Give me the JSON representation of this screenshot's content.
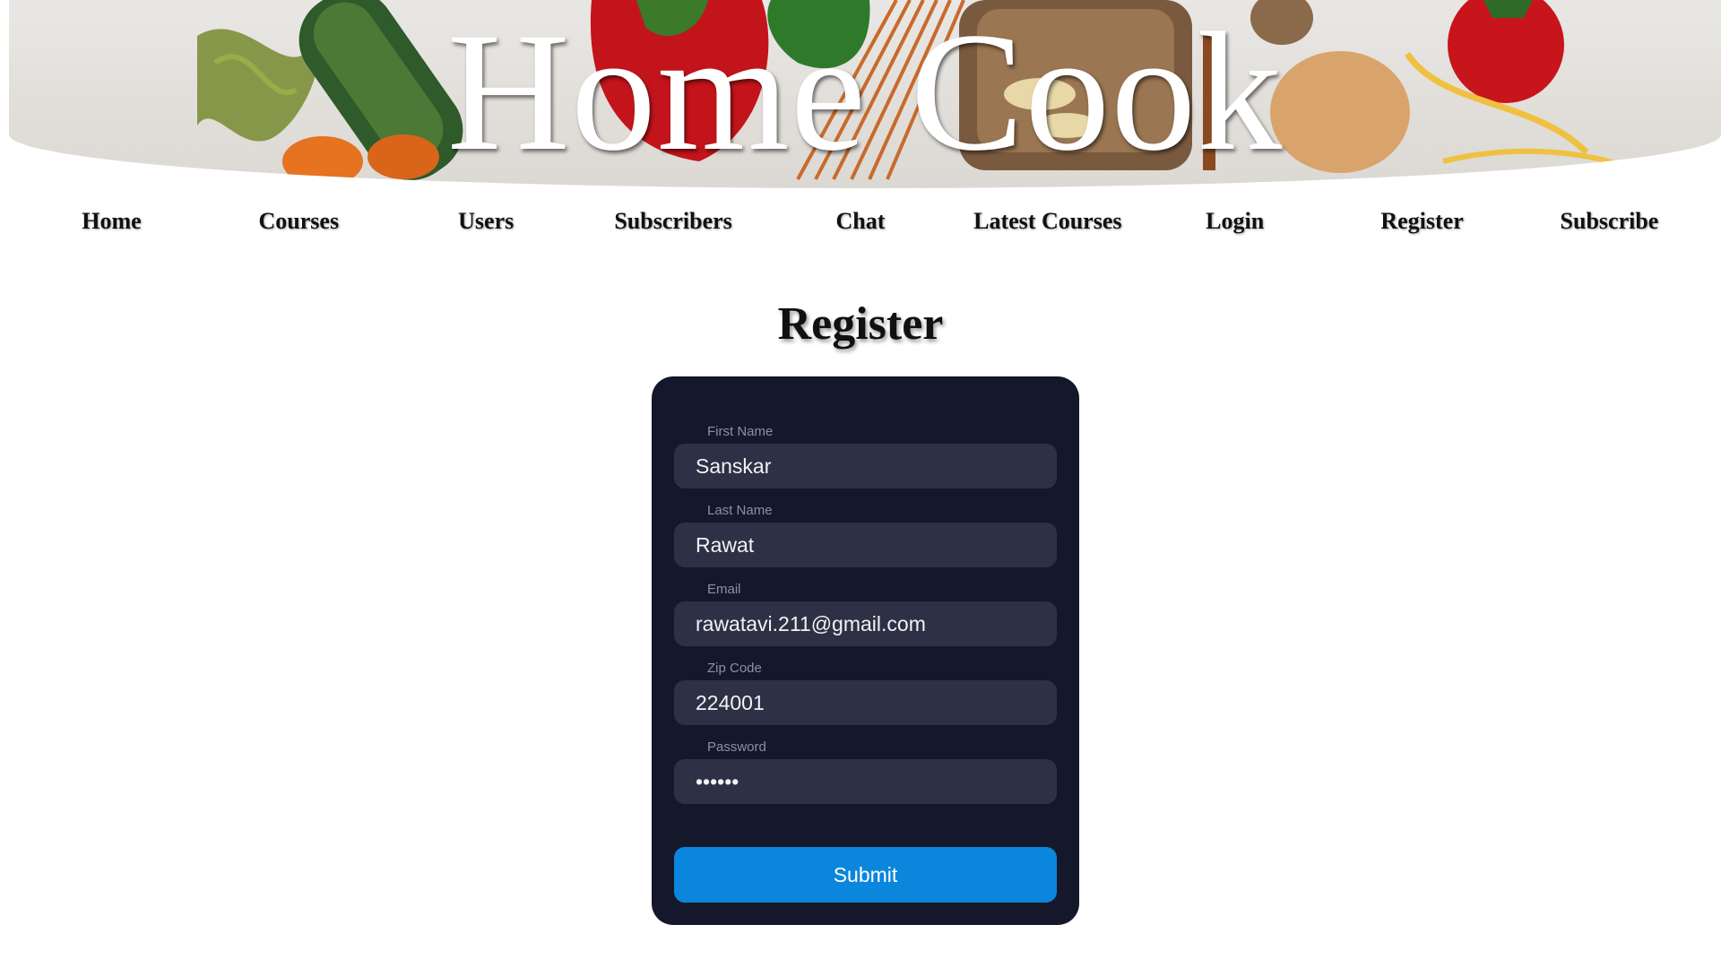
{
  "banner": {
    "title": "Home Cook"
  },
  "nav": {
    "items": [
      {
        "label": "Home"
      },
      {
        "label": "Courses"
      },
      {
        "label": "Users"
      },
      {
        "label": "Subscribers"
      },
      {
        "label": "Chat"
      },
      {
        "label": "Latest Courses"
      },
      {
        "label": "Login"
      },
      {
        "label": "Register"
      },
      {
        "label": "Subscribe"
      }
    ]
  },
  "page": {
    "title": "Register"
  },
  "form": {
    "fields": [
      {
        "label": "First Name",
        "value": "Sanskar"
      },
      {
        "label": "Last Name",
        "value": "Rawat"
      },
      {
        "label": "Email",
        "value": "rawatavi.211@gmail.com"
      },
      {
        "label": "Zip Code",
        "value": "224001"
      },
      {
        "label": "Password",
        "value": "••••••"
      }
    ],
    "submit_label": "Submit"
  },
  "colors": {
    "card_bg": "#15182a",
    "input_bg": "#2e3146",
    "submit_bg": "#0a86dc"
  }
}
